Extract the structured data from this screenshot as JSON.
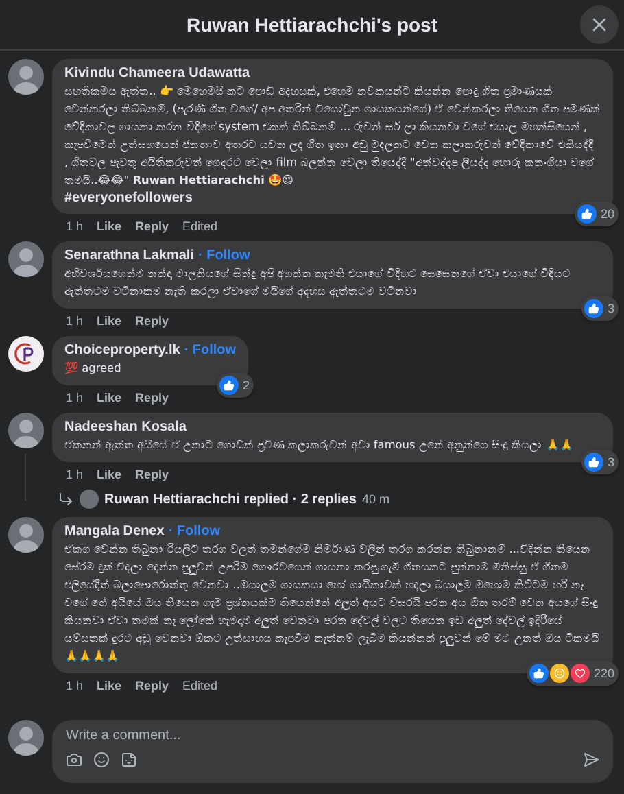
{
  "header": {
    "title": "Ruwan Hettiarachchi's post"
  },
  "comments": [
    {
      "author": "Kivindu Chameera Udawatta",
      "page_logo": false,
      "text": "සහතිකමය ඇත්ත.. 👉 මෙහෙමයි කට පොඩි අදහසක්, එහෙම නවකයන්ට කියන්න පොදු ගීත ප්‍රමාණයක් වෙන්කරලා තිබ්බනම්, (පැරණි ගීත වගේ/ අප අතරින් වියෝවුන ගායකයන්ගේ) ඒ වෙන්කරලා තියෙන ගීත පමණක් වේදිකාවල ගායනා කරන විදිහේ system එකක් තිබ්බනම් ... රුවන් සර් ලා කියනවා වගේ එයාල මහන්සියෙන් , කැපවීමෙන් උත්සහයෙන් ජනතාව අතරට යවන ලද ගීත ඉතා අඩු මුදලකට වෙන කලාකරුවන් වේදිකාවේ එකියද්දී , ගීතවල පැවතු අයිතිකරුවන් ගෙදරට වෙලා film බලන්න වෙලා තියෙද්දී \"අන්වද්දපු ලියද්ද හොරු කනංගියා වගේ තමයි..😂😂\" **Ruwan Hettiarachchi** 🤩😍",
      "hashtag": "#everyonefollowers",
      "time": "1 h",
      "like": "Like",
      "reply": "Reply",
      "edited": "Edited",
      "reactions": {
        "like": true,
        "haha": false,
        "love": false
      },
      "count": "20"
    },
    {
      "author": "Senarathna Lakmali",
      "page_logo": false,
      "follow": "· Follow",
      "text": "අභිවර්ශයගෙන්ම නන්දා මාලනියගේ සින්දු අපි අහන්න කැමති එයාගේ විදිහට සෙසෙනගේ ඒවා එයාගේ විදියට ඇත්තටම වටිනාකම නැති කරලා ඒවාගේ මයිගේ අදහස ඇත්තටම වටිනවා",
      "time": "1 h",
      "like": "Like",
      "reply": "Reply",
      "reactions": {
        "like": true,
        "haha": false,
        "love": false
      },
      "count": "3"
    },
    {
      "author": "Choiceproperty.lk",
      "page_logo": true,
      "follow": "· Follow",
      "text": "💯 agreed",
      "time": "1 h",
      "like": "Like",
      "reply": "Reply",
      "reactions": {
        "like": true,
        "haha": false,
        "love": false
      },
      "count": "2"
    },
    {
      "author": "Nadeeshan Kosala",
      "page_logo": false,
      "text": "ඒකනන් ඇත්ත අයියේ ඒ උනාට ගොඩක් ප්‍රවීණ කලාකරුවන් අවා famous උනේ අනුන්ගෙ සිංදු කියලා 🙏🙏",
      "time": "1 h",
      "like": "Like",
      "reply": "Reply",
      "reactions": {
        "like": true,
        "haha": false,
        "love": false
      },
      "count": "3",
      "replies": {
        "text": "Ruwan Hettiarachchi replied · 2 replies",
        "time": "40 m"
      }
    },
    {
      "author": "Mangala Denex",
      "page_logo": false,
      "follow": "· Follow",
      "text": "ඒකග වෙන්න තිබුනා රියලිටි තරග වලත් තමන්ගේම නිර්මාණ වලින් තරග කරන්න තිබුනානම් ...විදින්න තියෙන සේරම දුක් විදලා දෙන්න පුලුවන් උපරිම ගෞරවයෙන් ගායනා කරපු ගැමි ගීතයකට පුන්නාම මිනිස්සු ඒ ගීතම එලියේදීත් බලාපොරොත්තු වෙනවා ..ඔයාලම ගායකයා හෝ ගායිකාවක් හදලා බයාලම ඔහොම කිට්ටම හරි නෑ වගේ තේ අයියේ ඔය තියෙන ගැම ප්‍රශ්නයක්ම තියෙන්නේ අලුත් අයට විසරයි පරන අය ඕන තරම් වෙන අයගේ සිංදු කියනවා ඒවා නමක් නෑ ලෝකේ හැමදාම අලුත් වෙනවා පරන දේවල් වලට තියෙන ඉඩ අලුත් දේවල් ඉදිරියේ යම්සතක් දුරට අඩු වෙනවා ඕකට උත්සාහය කැපවීම නැත්නම් ලැබීම කියන්නක් පුලුවන් මේ මට උනත් ඔය ටිකමයි 🙏🙏🙏🙏",
      "time": "1 h",
      "like": "Like",
      "reply": "Reply",
      "edited": "Edited",
      "reactions": {
        "like": true,
        "haha": true,
        "love": true
      },
      "count": "220"
    }
  ],
  "composer": {
    "placeholder": "Write a comment..."
  }
}
